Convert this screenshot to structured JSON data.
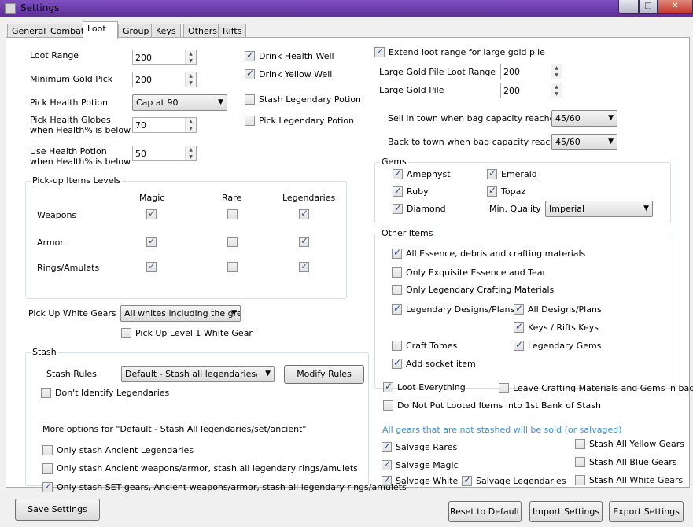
{
  "window": {
    "title": "Settings",
    "min": "—",
    "max": "□",
    "close": "✕"
  },
  "tabs": [
    "General",
    "Combat",
    "Loot",
    "Group",
    "Keys",
    "Others",
    "Rifts"
  ],
  "left": {
    "loot_range": {
      "label": "Loot Range",
      "value": "200"
    },
    "min_gold": {
      "label": "Minimum Gold Pick",
      "value": "200"
    },
    "pick_health_potion": {
      "label": "Pick Health Potion",
      "value": "Cap at 90"
    },
    "pick_health_globes": {
      "label1": "Pick Health Globes",
      "label2": "when Health% is below",
      "value": "70"
    },
    "use_health_potion": {
      "label1": "Use Health Potion",
      "label2": "when Health% is below",
      "value": "50"
    },
    "drink_health_well": "Drink Health Well",
    "drink_yellow_well": "Drink Yellow Well",
    "stash_legendary_potion": "Stash Legendary Potion",
    "pick_legendary_potion": "Pick Legendary Potion"
  },
  "pickup_levels": {
    "title": "Pick-up Items Levels",
    "columns": [
      "Magic",
      "Rare",
      "Legendaries"
    ],
    "rows": [
      "Weapons",
      "Armor",
      "Rings/Amulets"
    ]
  },
  "white_gears": {
    "label": "Pick Up White Gears",
    "value": "All whites including the grey",
    "level1": "Pick Up Level 1 White Gear"
  },
  "stash": {
    "title": "Stash",
    "rules_label": "Stash Rules",
    "rules_value": "Default - Stash all legendaries/set/ancient",
    "modify_button": "Modify Rules",
    "dont_identify": "Don't Identify Legendaries",
    "more_options": "More options for \"Default - Stash All legendaries/set/ancient\"",
    "opt1": "Only stash Ancient Legendaries",
    "opt2": "Only stash Ancient weapons/armor, stash all legendary rings/amulets",
    "opt3": "Only stash SET gears, Ancient weapons/armor, stash all legendary rings/amulets"
  },
  "right": {
    "extend_loot": "Extend loot range for large gold pile",
    "large_gold_range": {
      "label": "Large Gold Pile Loot Range",
      "value": "200"
    },
    "large_gold_pile": {
      "label": "Large Gold Pile",
      "value": "200"
    },
    "sell_in_town": {
      "label": "Sell in town when bag capacity reaches",
      "value": "45/60"
    },
    "back_to_town": {
      "label": "Back to town when bag capacity reaches",
      "value": "45/60"
    }
  },
  "gems": {
    "title": "Gems",
    "amethyst": "Amephyst",
    "emerald": "Emerald",
    "ruby": "Ruby",
    "topaz": "Topaz",
    "diamond": "Diamond",
    "min_quality_label": "Min. Quality",
    "min_quality_value": "Imperial"
  },
  "other_items": {
    "title": "Other Items",
    "essence": "All Essence, debris and crafting materials",
    "exquisite": "Only Exquisite Essence and Tear",
    "only_legendary_crafting": "Only Legendary Crafting Materials",
    "legendary_designs": "Legendary Designs/Plans",
    "all_designs": "All Designs/Plans",
    "keys": "Keys / Rifts Keys",
    "craft_tomes": "Craft Tomes",
    "legendary_gems": "Legendary Gems",
    "socket": "Add socket item"
  },
  "bottom_right": {
    "loot_everything": "Loot Everything",
    "leave_crafting": "Leave Crafting Materials and Gems in bag",
    "do_not_put": "Do Not Put Looted Items into 1st Bank of Stash",
    "sold_note": "All gears that are not stashed will be sold (or salvaged)",
    "salvage_rares": "Salvage Rares",
    "salvage_magic": "Salvage Magic",
    "salvage_white": "Salvage White",
    "salvage_legendaries": "Salvage Legendaries",
    "stash_yellow": "Stash All Yellow Gears",
    "stash_blue": "Stash All Blue Gears",
    "stash_white": "Stash All White Gears"
  },
  "footer": {
    "save": "Save Settings",
    "reset": "Reset to Default",
    "import": "Import Settings",
    "export": "Export Settings"
  },
  "arrows": {
    "up": "▲",
    "down": "▼"
  }
}
